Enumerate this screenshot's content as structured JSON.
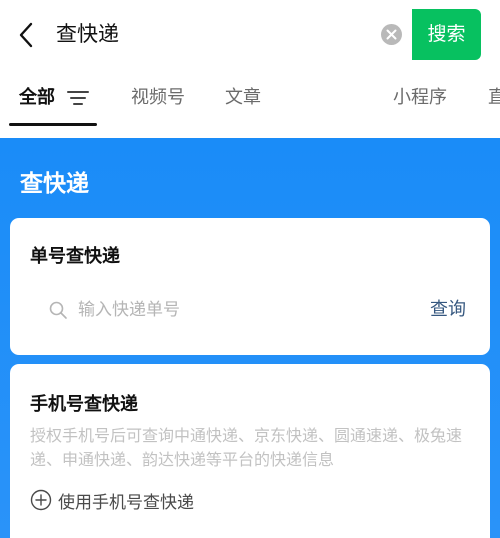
{
  "search": {
    "query": "查快递",
    "button_label": "搜索"
  },
  "tabs": [
    {
      "label": "全部",
      "active": true
    },
    {
      "label": "视频号"
    },
    {
      "label": "文章"
    },
    {
      "label": "小程序"
    },
    {
      "label": "直"
    }
  ],
  "panel": {
    "title": "查快递",
    "tracking_card": {
      "title": "单号查快递",
      "input_placeholder": "输入快递单号",
      "query_label": "查询"
    },
    "phone_card": {
      "title": "手机号查快递",
      "description": "授权手机号后可查询中通快递、京东快递、圆通速递、极兔速递、申通快递、韵达快递等平台的快递信息",
      "action_label": "使用手机号查快递"
    }
  },
  "colors": {
    "accent_green": "#07c160",
    "panel_blue": "#1a8cf8",
    "link_blue": "#35577f"
  },
  "icons": [
    "back-icon",
    "clear-icon",
    "filter-icon",
    "search-icon",
    "plus-circle-icon"
  ]
}
